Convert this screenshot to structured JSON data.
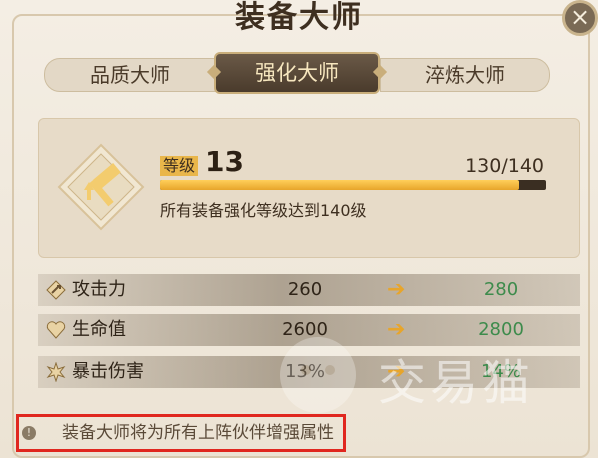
{
  "window": {
    "title": "装备大师"
  },
  "tabs": [
    {
      "label": "品质大师"
    },
    {
      "label": "强化大师"
    },
    {
      "label": "淬炼大师"
    }
  ],
  "level": {
    "label": "等级",
    "value": "13",
    "progress_text": "130/140",
    "progress_fraction": 0.93,
    "description": "所有装备强化等级达到140级"
  },
  "stats": [
    {
      "icon": "attack-icon",
      "name": "攻击力",
      "current": "260",
      "next": "280"
    },
    {
      "icon": "heart-icon",
      "name": "生命值",
      "current": "2600",
      "next": "2800"
    },
    {
      "icon": "crit-star-icon",
      "name": "暴击伤害",
      "current": "13%",
      "next": "14%"
    }
  ],
  "tip": {
    "text": "装备大师将为所有上阵伙伴增强属性"
  },
  "watermark": {
    "text": "交易猫"
  },
  "colors": {
    "accent": "#e9b64a",
    "increase": "#3d8b4c",
    "highlight_border": "#e0271f"
  }
}
